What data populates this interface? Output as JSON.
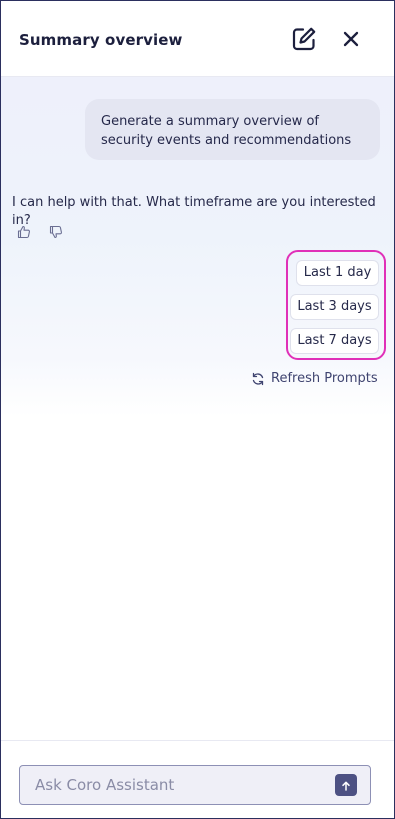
{
  "header": {
    "title": "Summary overview",
    "edit_icon": "edit-square-icon",
    "close_icon": "close-icon"
  },
  "conversation": {
    "user_message": "Generate a summary overview of security events and recommendations",
    "assistant_message": "I can help with that. What timeframe are you interested in?",
    "feedback": {
      "thumbs_up_icon": "thumbs-up-icon",
      "thumbs_down_icon": "thumbs-down-icon"
    },
    "suggested_prompts": [
      "Last 1 day",
      "Last 3 days",
      "Last 7 days"
    ],
    "refresh_label": "Refresh Prompts"
  },
  "composer": {
    "placeholder": "Ask Coro Assistant",
    "value": "",
    "send_icon": "arrow-up-icon"
  },
  "colors": {
    "highlight": "#e030b8",
    "send_button": "#4d5183",
    "user_bubble": "#e4e6f2",
    "title": "#1c1f3d"
  }
}
